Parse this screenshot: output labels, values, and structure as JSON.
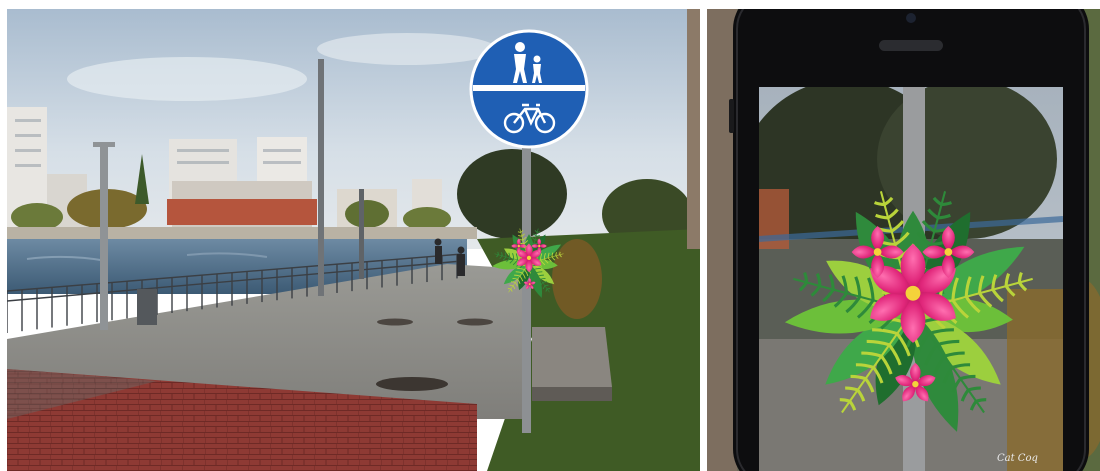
{
  "scene": {
    "left_photo": {
      "subject": "street-sign-with-floral-ar-overlay",
      "sign_pictograms": [
        "pedestrian-adult-child-icon",
        "bicycle-icon"
      ],
      "sign_color": "#1f5fb4"
    },
    "right_photo": {
      "subject": "smartphone-ar-view",
      "signature": "Cat Coq"
    }
  },
  "colors": {
    "sky": "#c9d6e3",
    "river": "#4a6a86",
    "grass": "#3d5a24",
    "brick": "#8e3a34",
    "phone_body": "#0d0d0f",
    "flower_pink": "#e0267a",
    "leaf_green": "#2f8a3c"
  }
}
